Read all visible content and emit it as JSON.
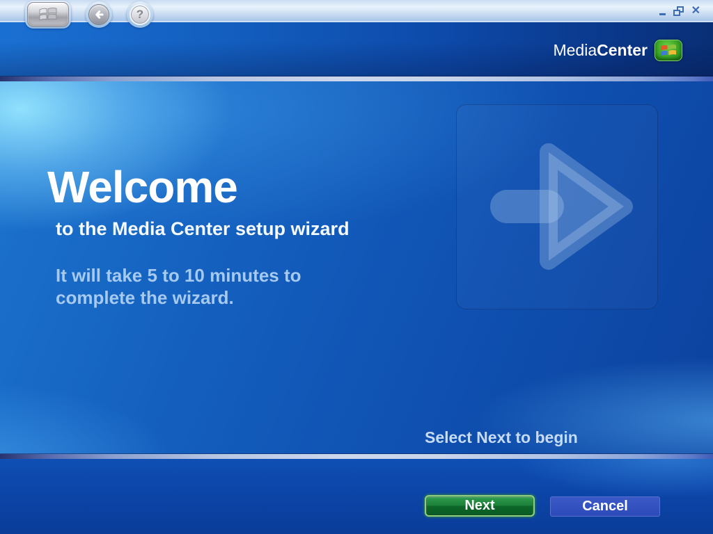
{
  "titlebar": {
    "close_icon": "✕",
    "help_icon": "?"
  },
  "header": {
    "brand": {
      "media": "Media",
      "center": "Center"
    }
  },
  "content": {
    "title": "Welcome",
    "subtitle": "to the Media Center setup wizard",
    "body_line1": "It will take 5 to 10 minutes to",
    "body_line2": "complete the wizard.",
    "hint": "Select Next to begin"
  },
  "footer": {
    "next_label": "Next",
    "cancel_label": "Cancel"
  },
  "colors": {
    "header_navy": "#092f76",
    "content_blue": "#145fbe",
    "highlight_cyan": "#96e6ff",
    "next_green": "#1b8038",
    "cancel_blue": "#2d4aba",
    "divider_silver": "#ccd7ec",
    "body_text": "#a6c9ef"
  }
}
